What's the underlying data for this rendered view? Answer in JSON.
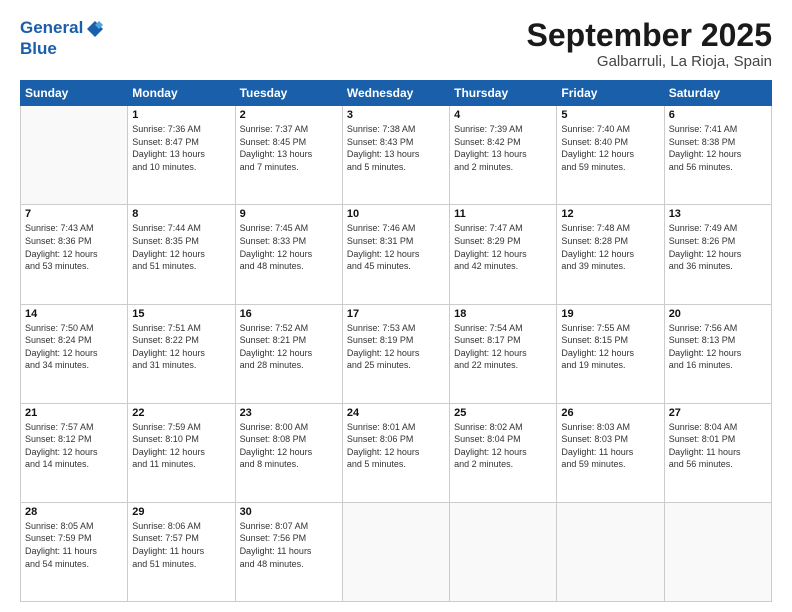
{
  "header": {
    "logo_line1": "General",
    "logo_line2": "Blue",
    "month": "September 2025",
    "location": "Galbarruli, La Rioja, Spain"
  },
  "weekdays": [
    "Sunday",
    "Monday",
    "Tuesday",
    "Wednesday",
    "Thursday",
    "Friday",
    "Saturday"
  ],
  "weeks": [
    [
      {
        "day": "",
        "info": ""
      },
      {
        "day": "1",
        "info": "Sunrise: 7:36 AM\nSunset: 8:47 PM\nDaylight: 13 hours\nand 10 minutes."
      },
      {
        "day": "2",
        "info": "Sunrise: 7:37 AM\nSunset: 8:45 PM\nDaylight: 13 hours\nand 7 minutes."
      },
      {
        "day": "3",
        "info": "Sunrise: 7:38 AM\nSunset: 8:43 PM\nDaylight: 13 hours\nand 5 minutes."
      },
      {
        "day": "4",
        "info": "Sunrise: 7:39 AM\nSunset: 8:42 PM\nDaylight: 13 hours\nand 2 minutes."
      },
      {
        "day": "5",
        "info": "Sunrise: 7:40 AM\nSunset: 8:40 PM\nDaylight: 12 hours\nand 59 minutes."
      },
      {
        "day": "6",
        "info": "Sunrise: 7:41 AM\nSunset: 8:38 PM\nDaylight: 12 hours\nand 56 minutes."
      }
    ],
    [
      {
        "day": "7",
        "info": "Sunrise: 7:43 AM\nSunset: 8:36 PM\nDaylight: 12 hours\nand 53 minutes."
      },
      {
        "day": "8",
        "info": "Sunrise: 7:44 AM\nSunset: 8:35 PM\nDaylight: 12 hours\nand 51 minutes."
      },
      {
        "day": "9",
        "info": "Sunrise: 7:45 AM\nSunset: 8:33 PM\nDaylight: 12 hours\nand 48 minutes."
      },
      {
        "day": "10",
        "info": "Sunrise: 7:46 AM\nSunset: 8:31 PM\nDaylight: 12 hours\nand 45 minutes."
      },
      {
        "day": "11",
        "info": "Sunrise: 7:47 AM\nSunset: 8:29 PM\nDaylight: 12 hours\nand 42 minutes."
      },
      {
        "day": "12",
        "info": "Sunrise: 7:48 AM\nSunset: 8:28 PM\nDaylight: 12 hours\nand 39 minutes."
      },
      {
        "day": "13",
        "info": "Sunrise: 7:49 AM\nSunset: 8:26 PM\nDaylight: 12 hours\nand 36 minutes."
      }
    ],
    [
      {
        "day": "14",
        "info": "Sunrise: 7:50 AM\nSunset: 8:24 PM\nDaylight: 12 hours\nand 34 minutes."
      },
      {
        "day": "15",
        "info": "Sunrise: 7:51 AM\nSunset: 8:22 PM\nDaylight: 12 hours\nand 31 minutes."
      },
      {
        "day": "16",
        "info": "Sunrise: 7:52 AM\nSunset: 8:21 PM\nDaylight: 12 hours\nand 28 minutes."
      },
      {
        "day": "17",
        "info": "Sunrise: 7:53 AM\nSunset: 8:19 PM\nDaylight: 12 hours\nand 25 minutes."
      },
      {
        "day": "18",
        "info": "Sunrise: 7:54 AM\nSunset: 8:17 PM\nDaylight: 12 hours\nand 22 minutes."
      },
      {
        "day": "19",
        "info": "Sunrise: 7:55 AM\nSunset: 8:15 PM\nDaylight: 12 hours\nand 19 minutes."
      },
      {
        "day": "20",
        "info": "Sunrise: 7:56 AM\nSunset: 8:13 PM\nDaylight: 12 hours\nand 16 minutes."
      }
    ],
    [
      {
        "day": "21",
        "info": "Sunrise: 7:57 AM\nSunset: 8:12 PM\nDaylight: 12 hours\nand 14 minutes."
      },
      {
        "day": "22",
        "info": "Sunrise: 7:59 AM\nSunset: 8:10 PM\nDaylight: 12 hours\nand 11 minutes."
      },
      {
        "day": "23",
        "info": "Sunrise: 8:00 AM\nSunset: 8:08 PM\nDaylight: 12 hours\nand 8 minutes."
      },
      {
        "day": "24",
        "info": "Sunrise: 8:01 AM\nSunset: 8:06 PM\nDaylight: 12 hours\nand 5 minutes."
      },
      {
        "day": "25",
        "info": "Sunrise: 8:02 AM\nSunset: 8:04 PM\nDaylight: 12 hours\nand 2 minutes."
      },
      {
        "day": "26",
        "info": "Sunrise: 8:03 AM\nSunset: 8:03 PM\nDaylight: 11 hours\nand 59 minutes."
      },
      {
        "day": "27",
        "info": "Sunrise: 8:04 AM\nSunset: 8:01 PM\nDaylight: 11 hours\nand 56 minutes."
      }
    ],
    [
      {
        "day": "28",
        "info": "Sunrise: 8:05 AM\nSunset: 7:59 PM\nDaylight: 11 hours\nand 54 minutes."
      },
      {
        "day": "29",
        "info": "Sunrise: 8:06 AM\nSunset: 7:57 PM\nDaylight: 11 hours\nand 51 minutes."
      },
      {
        "day": "30",
        "info": "Sunrise: 8:07 AM\nSunset: 7:56 PM\nDaylight: 11 hours\nand 48 minutes."
      },
      {
        "day": "",
        "info": ""
      },
      {
        "day": "",
        "info": ""
      },
      {
        "day": "",
        "info": ""
      },
      {
        "day": "",
        "info": ""
      }
    ]
  ]
}
